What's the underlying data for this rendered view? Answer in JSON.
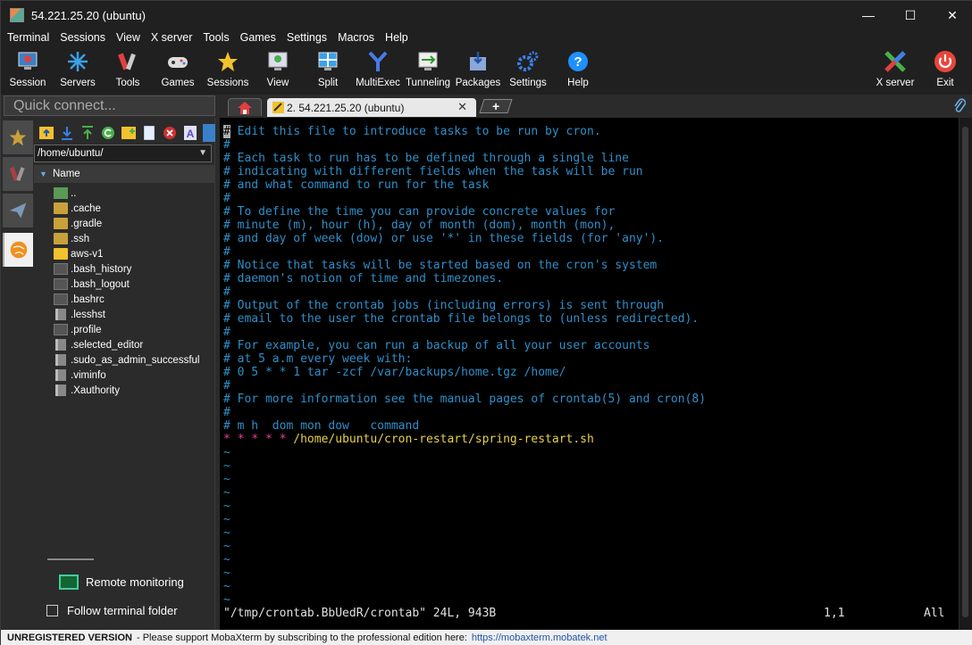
{
  "window": {
    "title": "54.221.25.20 (ubuntu)",
    "minimize": "—",
    "maximize": "☐",
    "close": "✕"
  },
  "menu": [
    "Terminal",
    "Sessions",
    "View",
    "X server",
    "Tools",
    "Games",
    "Settings",
    "Macros",
    "Help"
  ],
  "toolbar": [
    {
      "label": "Session",
      "icon": "session-icon",
      "color": "#e04040"
    },
    {
      "label": "Servers",
      "icon": "servers-icon",
      "color": "#3aa0e8"
    },
    {
      "label": "Tools",
      "icon": "tools-icon",
      "color": "#e04040"
    },
    {
      "label": "Games",
      "icon": "games-icon",
      "color": "#dddddd"
    },
    {
      "label": "Sessions",
      "icon": "star-icon",
      "color": "#f2c12e"
    },
    {
      "label": "View",
      "icon": "view-icon",
      "color": "#4ab04a"
    },
    {
      "label": "Split",
      "icon": "split-icon",
      "color": "#3aa0e8"
    },
    {
      "label": "MultiExec",
      "icon": "multiexec-icon",
      "color": "#4a7ae8"
    },
    {
      "label": "Tunneling",
      "icon": "tunneling-icon",
      "color": "#4ab04a"
    },
    {
      "label": "Packages",
      "icon": "packages-icon",
      "color": "#8aa8d8"
    },
    {
      "label": "Settings",
      "icon": "settings-icon",
      "color": "#3a80e8"
    },
    {
      "label": "Help",
      "icon": "help-icon",
      "color": "#1e90ff"
    }
  ],
  "toolbar_right": [
    {
      "label": "X server",
      "icon": "xserver-icon"
    },
    {
      "label": "Exit",
      "icon": "exit-icon"
    }
  ],
  "quick_connect": {
    "placeholder": "Quick connect..."
  },
  "tabs": {
    "session_tab": "2. 54.221.25.20 (ubuntu)",
    "close": "✕",
    "add": "+"
  },
  "file_browser": {
    "path": "/home/ubuntu/",
    "column": "Name",
    "items": [
      {
        "name": "..",
        "kind": "up"
      },
      {
        "name": ".cache",
        "kind": "folder"
      },
      {
        "name": ".gradle",
        "kind": "folder"
      },
      {
        "name": ".ssh",
        "kind": "folder"
      },
      {
        "name": "aws-v1",
        "kind": "folder-bright"
      },
      {
        "name": ".bash_history",
        "kind": "file"
      },
      {
        "name": ".bash_logout",
        "kind": "file"
      },
      {
        "name": ".bashrc",
        "kind": "file"
      },
      {
        "name": ".lesshst",
        "kind": "doc"
      },
      {
        "name": ".profile",
        "kind": "file"
      },
      {
        "name": ".selected_editor",
        "kind": "doc"
      },
      {
        "name": ".sudo_as_admin_successful",
        "kind": "doc"
      },
      {
        "name": ".viminfo",
        "kind": "doc"
      },
      {
        "name": ".Xauthority",
        "kind": "doc"
      }
    ],
    "remote_monitoring": "Remote monitoring",
    "follow_terminal": "Follow terminal folder"
  },
  "terminal": {
    "lines": [
      " Edit this file to introduce tasks to be run by cron.",
      "#",
      "# Each task to run has to be defined through a single line",
      "# indicating with different fields when the task will be run",
      "# and what command to run for the task",
      "#",
      "# To define the time you can provide concrete values for",
      "# minute (m), hour (h), day of month (dom), month (mon),",
      "# and day of week (dow) or use '*' in these fields (for 'any').",
      "#",
      "# Notice that tasks will be started based on the cron's system",
      "# daemon's notion of time and timezones.",
      "#",
      "# Output of the crontab jobs (including errors) is sent through",
      "# email to the user the crontab file belongs to (unless redirected).",
      "#",
      "# For example, you can run a backup of all your user accounts",
      "# at 5 a.m every week with:",
      "# 0 5 * * 1 tar -zcf /var/backups/home.tgz /home/",
      "#",
      "# For more information see the manual pages of crontab(5) and cron(8)",
      "#",
      "# m h  dom mon dow   command"
    ],
    "cursor_char": "#",
    "cron_entry": {
      "stars": [
        "*",
        "*",
        "*",
        "*",
        "*"
      ],
      "star_colors": [
        "#e040a0",
        "#e040a0",
        "#e040a0",
        "#e040a0",
        "#e040a0"
      ],
      "command": "/home/ubuntu/cron-restart/spring-restart.sh"
    },
    "tildes": [
      "~",
      "~",
      "~",
      "~",
      "~",
      "~",
      "~",
      "~",
      "~",
      "~",
      "~",
      "~"
    ],
    "status_file": "\"/tmp/crontab.BbUedR/crontab\" 24L, 943B",
    "status_pos": "1,1",
    "status_all": "All"
  },
  "statusbar": {
    "unregistered": "UNREGISTERED VERSION",
    "message": "-  Please support MobaXterm by subscribing to the professional edition here:",
    "link": "https://mobaxterm.mobatek.net"
  }
}
